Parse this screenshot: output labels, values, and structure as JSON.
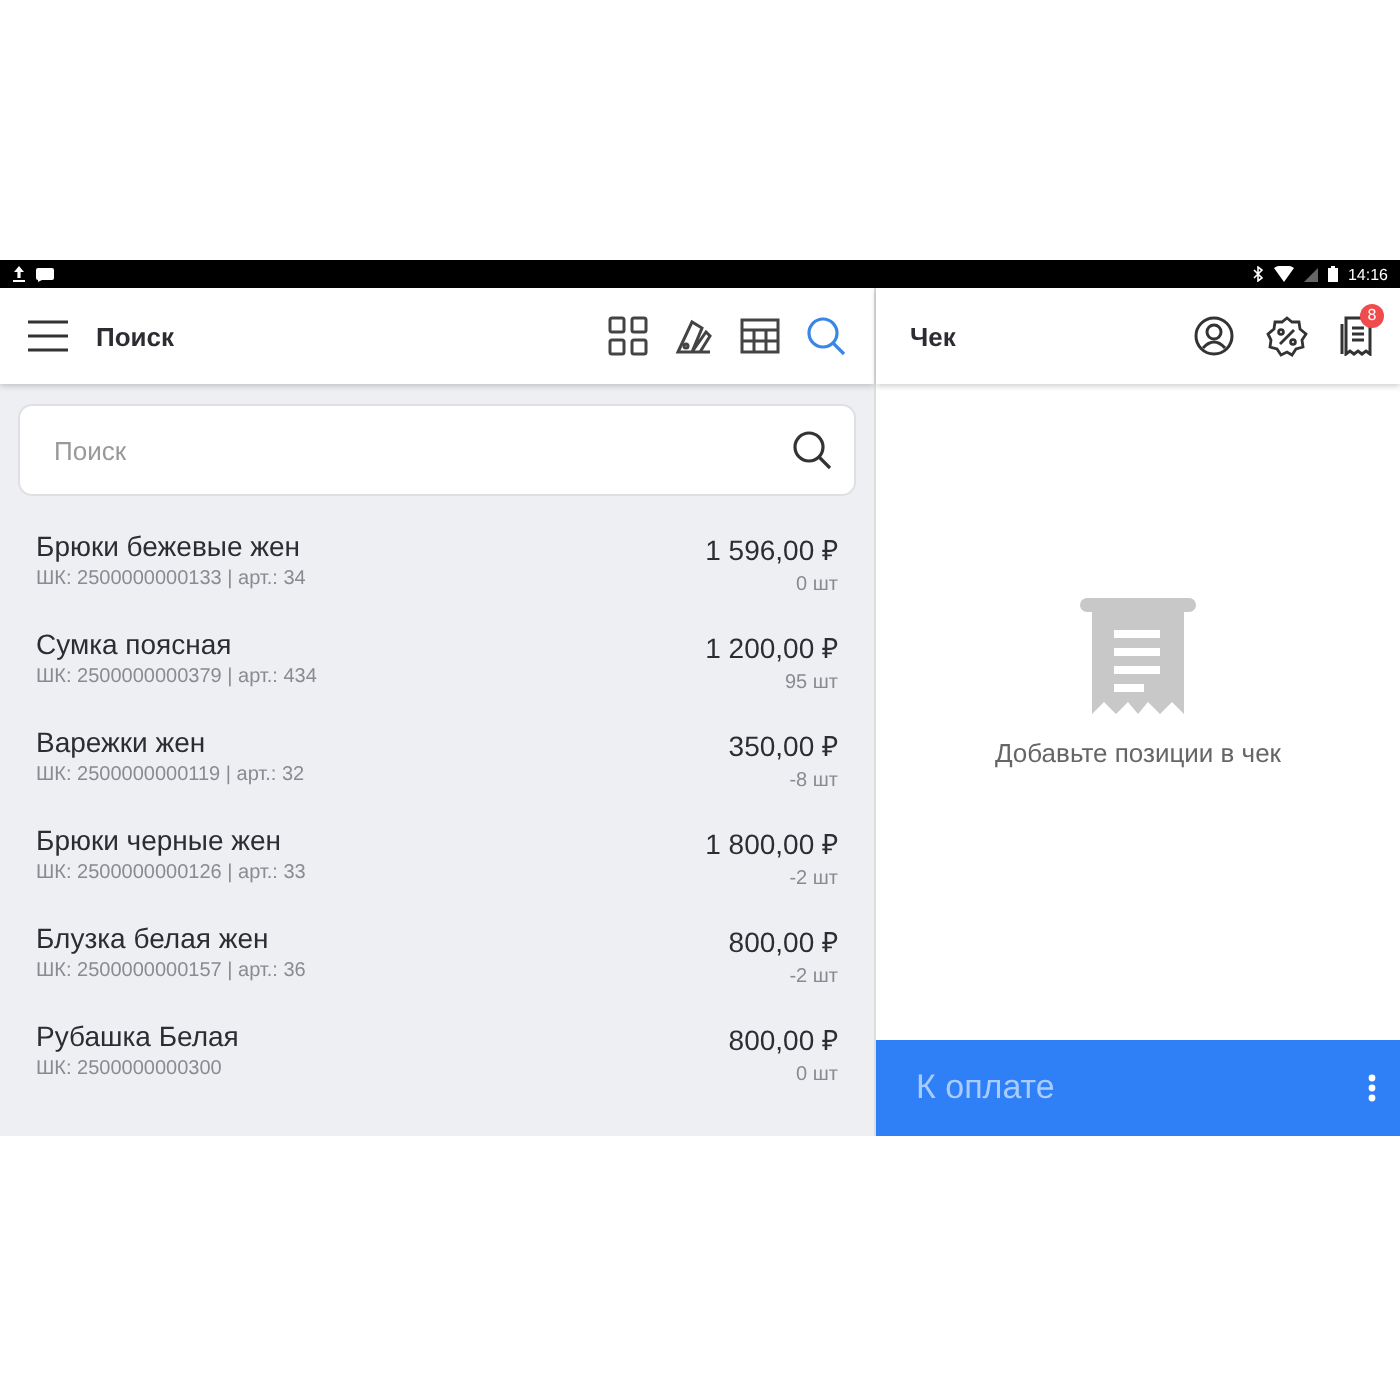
{
  "status_bar": {
    "time": "14:16"
  },
  "left_header": {
    "title": "Поиск",
    "view_buttons": [
      {
        "kind": "grid",
        "selected": false
      },
      {
        "kind": "palette",
        "selected": false
      },
      {
        "kind": "table",
        "selected": false
      },
      {
        "kind": "search",
        "selected": true
      }
    ]
  },
  "search": {
    "placeholder": "Поиск"
  },
  "products": [
    {
      "name": "Брюки бежевые жен",
      "code": "ШК: 2500000000133 | арт.: 34",
      "price": "1 596,00 ₽",
      "stock": "0 шт"
    },
    {
      "name": "Сумка поясная",
      "code": "ШК: 2500000000379 | арт.: 434",
      "price": "1 200,00 ₽",
      "stock": "95 шт"
    },
    {
      "name": "Варежки жен",
      "code": "ШК: 2500000000119 | арт.: 32",
      "price": "350,00 ₽",
      "stock": "-8 шт"
    },
    {
      "name": "Брюки черные жен",
      "code": "ШК: 2500000000126 | арт.: 33",
      "price": "1 800,00 ₽",
      "stock": "-2 шт"
    },
    {
      "name": "Блузка белая жен",
      "code": "ШК: 2500000000157 | арт.: 36",
      "price": "800,00 ₽",
      "stock": "-2 шт"
    },
    {
      "name": "Рубашка Белая",
      "code": "ШК: 2500000000300",
      "price": "800,00 ₽",
      "stock": "0 шт"
    }
  ],
  "receipt": {
    "title": "Чек",
    "badge": "8",
    "empty_message": "Добавьте позиции в чек",
    "pay_button": "К оплате"
  }
}
